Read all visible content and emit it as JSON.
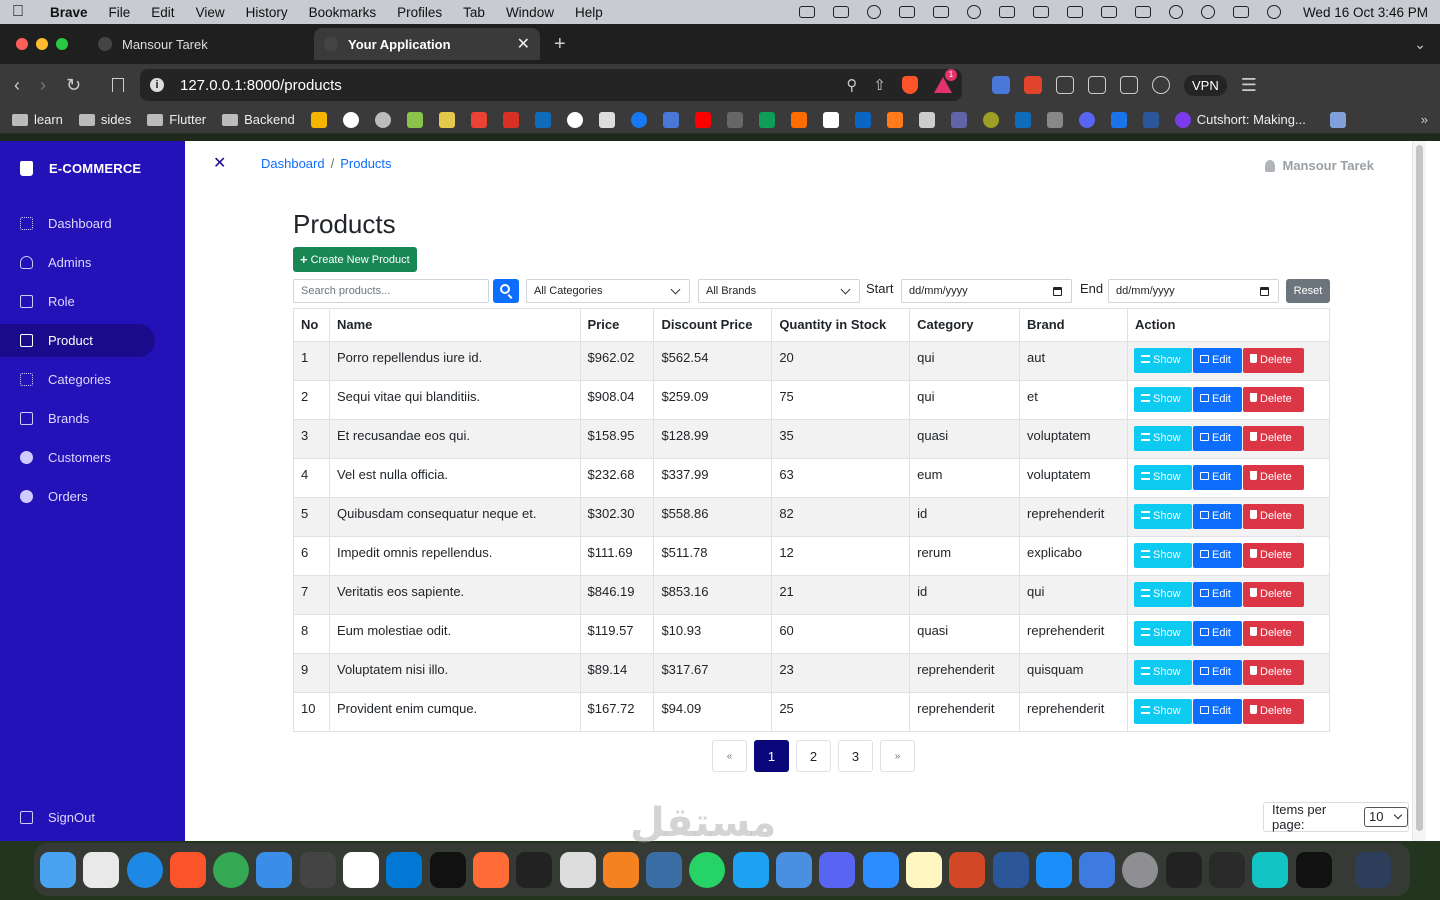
{
  "menubar": {
    "app": "Brave",
    "items": [
      "File",
      "Edit",
      "View",
      "History",
      "Bookmarks",
      "Profiles",
      "Tab",
      "Window",
      "Help"
    ],
    "clock": "Wed 16 Oct  3:46 PM"
  },
  "browser": {
    "tabs": [
      {
        "label": "Mansour Tarek",
        "active": false
      },
      {
        "label": "Your Application",
        "active": true
      }
    ],
    "url": "127.0.0.1:8000/products",
    "rewards_badge": "1",
    "vpn_label": "VPN",
    "bookmarks": {
      "folders": [
        "learn",
        "sides",
        "Flutter",
        "Backend"
      ],
      "last": "Cutshort: Making..."
    }
  },
  "sidebar": {
    "brand": "E-COMMERCE",
    "items": [
      {
        "label": "Dashboard",
        "icon": "grid-icon",
        "active": false
      },
      {
        "label": "Admins",
        "icon": "person-icon",
        "active": false
      },
      {
        "label": "Role",
        "icon": "bookmark-icon",
        "active": false
      },
      {
        "label": "Product",
        "icon": "folder-icon",
        "active": true
      },
      {
        "label": "Categories",
        "icon": "grid-icon",
        "active": false
      },
      {
        "label": "Brands",
        "icon": "tag-icon",
        "active": false
      },
      {
        "label": "Customers",
        "icon": "users-icon",
        "active": false
      },
      {
        "label": "Orders",
        "icon": "boxes-icon",
        "active": false
      }
    ],
    "signout": "SignOut"
  },
  "header": {
    "breadcrumb": [
      "Dashboard",
      "Products"
    ],
    "user": "Mansour Tarek"
  },
  "page": {
    "title": "Products",
    "create_label": "Create New Product"
  },
  "filters": {
    "search_placeholder": "Search products...",
    "category": "All Categories",
    "brand": "All Brands",
    "start_label": "Start",
    "start_placeholder": "dd/mm/yyyy",
    "end_label": "End",
    "end_placeholder": "dd/mm/yyyy",
    "reset_label": "Reset"
  },
  "table": {
    "columns": [
      "No",
      "Name",
      "Price",
      "Discount Price",
      "Quantity in Stock",
      "Category",
      "Brand",
      "Action"
    ],
    "actions": {
      "show": "Show",
      "edit": "Edit",
      "delete": "Delete"
    },
    "rows": [
      {
        "no": "1",
        "name": "Porro repellendus iure id.",
        "price": "$962.02",
        "discount": "$562.54",
        "qty": "20",
        "category": "qui",
        "brand": "aut"
      },
      {
        "no": "2",
        "name": "Sequi vitae qui blanditiis.",
        "price": "$908.04",
        "discount": "$259.09",
        "qty": "75",
        "category": "qui",
        "brand": "et"
      },
      {
        "no": "3",
        "name": "Et recusandae eos qui.",
        "price": "$158.95",
        "discount": "$128.99",
        "qty": "35",
        "category": "quasi",
        "brand": "voluptatem"
      },
      {
        "no": "4",
        "name": "Vel est nulla officia.",
        "price": "$232.68",
        "discount": "$337.99",
        "qty": "63",
        "category": "eum",
        "brand": "voluptatem"
      },
      {
        "no": "5",
        "name": "Quibusdam consequatur neque et.",
        "price": "$302.30",
        "discount": "$558.86",
        "qty": "82",
        "category": "id",
        "brand": "reprehenderit"
      },
      {
        "no": "6",
        "name": "Impedit omnis repellendus.",
        "price": "$111.69",
        "discount": "$511.78",
        "qty": "12",
        "category": "rerum",
        "brand": "explicabo"
      },
      {
        "no": "7",
        "name": "Veritatis eos sapiente.",
        "price": "$846.19",
        "discount": "$853.16",
        "qty": "21",
        "category": "id",
        "brand": "qui"
      },
      {
        "no": "8",
        "name": "Eum molestiae odit.",
        "price": "$119.57",
        "discount": "$10.93",
        "qty": "60",
        "category": "quasi",
        "brand": "reprehenderit"
      },
      {
        "no": "9",
        "name": "Voluptatem nisi illo.",
        "price": "$89.14",
        "discount": "$317.67",
        "qty": "23",
        "category": "reprehenderit",
        "brand": "quisquam"
      },
      {
        "no": "10",
        "name": "Provident enim cumque.",
        "price": "$167.72",
        "discount": "$94.09",
        "qty": "25",
        "category": "reprehenderit",
        "brand": "reprehenderit"
      }
    ]
  },
  "pagination": {
    "prev": "«",
    "pages": [
      "1",
      "2",
      "3"
    ],
    "current": "1",
    "next": "»"
  },
  "per_page": {
    "label": "Items per page:",
    "value": "10"
  },
  "watermark": "مستقل",
  "colors": {
    "sidebar": "#2312b8",
    "sidebar_active": "#1a0b8c",
    "create": "#198754",
    "show": "#0dcaf0",
    "edit": "#0d6efd",
    "delete": "#dc3545",
    "page_active": "#0b077a"
  }
}
